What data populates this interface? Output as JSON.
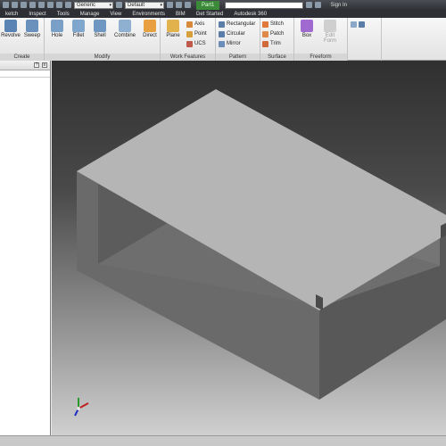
{
  "quick_access": {
    "material": "Generic",
    "appearance": "Default",
    "document_name": "Part1",
    "search_placeholder": "",
    "sign_in": "Sign In"
  },
  "tabs": [
    "ketch",
    "Inspect",
    "Tools",
    "Manage",
    "View",
    "Environments",
    "BIM",
    "Get Started",
    "Autodesk 360"
  ],
  "ribbon": {
    "create_label": "Create",
    "create_buttons": [
      "Revolve",
      "Sweep"
    ],
    "modify_label": "Modify",
    "modify_buttons": [
      "Hole",
      "Fillet",
      "Shell",
      "Combine",
      "Direct"
    ],
    "work_features_label": "Work Features",
    "plane": "Plane",
    "axis": "Axis",
    "point": "Point",
    "ucs": "UCS",
    "pattern_label": "Pattern",
    "rectangular": "Rectangular",
    "circular": "Circular",
    "mirror": "Mirror",
    "surface_label": "Surface",
    "stitch": "Stitch",
    "patch": "Patch",
    "trim": "Trim",
    "freeform_label": "Freeform",
    "box": "Box",
    "edit_form": "Edit Form"
  },
  "colors": {
    "viewport_top": "#303030",
    "viewport_bottom": "#d0d0d0",
    "model_top": "#b4b4b4",
    "model_side_front": "#6a6a6a",
    "model_side_right": "#5a5a5a"
  }
}
